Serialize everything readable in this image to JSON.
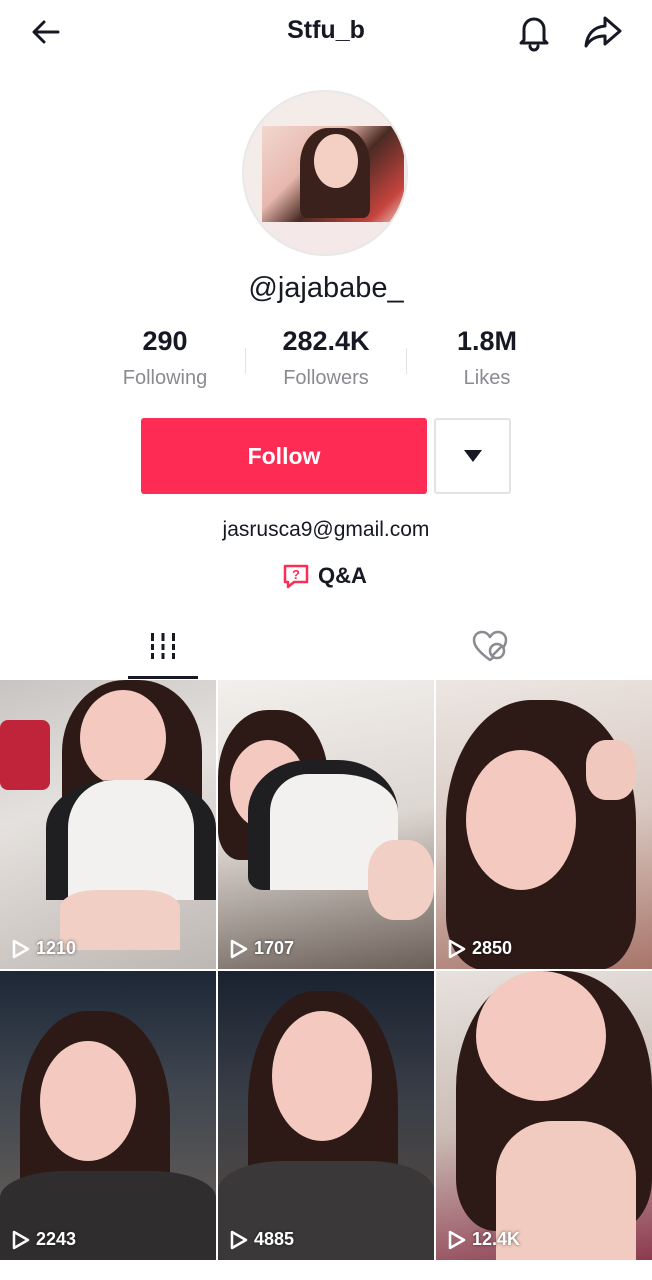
{
  "header": {
    "title": "Stfu_b",
    "back_icon": "arrow-left-icon",
    "bell_icon": "bell-icon",
    "share_icon": "share-arrow-icon"
  },
  "profile": {
    "handle": "@jajababe_",
    "stats": [
      {
        "value": "290",
        "label": "Following"
      },
      {
        "value": "282.4K",
        "label": "Followers"
      },
      {
        "value": "1.8M",
        "label": "Likes"
      }
    ],
    "follow_label": "Follow",
    "bio_email": "jasrusca9@gmail.com",
    "qa_label": "Q&A"
  },
  "tabs": {
    "videos_icon": "grid-videos-icon",
    "liked_icon": "liked-hidden-heart-icon"
  },
  "videos": [
    {
      "views": "1210"
    },
    {
      "views": "1707"
    },
    {
      "views": "2850"
    },
    {
      "views": "2243"
    },
    {
      "views": "4885"
    },
    {
      "views": "12.4K"
    }
  ],
  "colors": {
    "accent": "#fe2c55",
    "text_primary": "#161823",
    "text_secondary": "#8a8b91"
  }
}
